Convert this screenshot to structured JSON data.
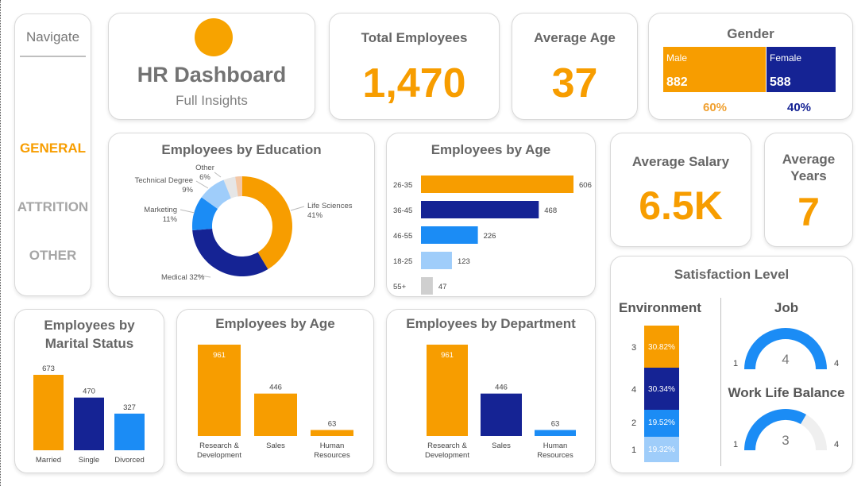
{
  "nav": {
    "title": "Navigate",
    "items": [
      "GENERAL",
      "ATTRITION",
      "OTHER"
    ]
  },
  "header": {
    "title": "HR Dashboard",
    "subtitle": "Full Insights"
  },
  "kpis": {
    "total_employees": {
      "label": "Total Employees",
      "value": "1,470"
    },
    "average_age": {
      "label": "Average Age",
      "value": "37"
    },
    "average_salary": {
      "label": "Average Salary",
      "value": "6.5K"
    },
    "average_years": {
      "label": "Average Years",
      "value": "7"
    }
  },
  "gender": {
    "title": "Gender",
    "male": {
      "label": "Male",
      "value": "882",
      "pct": "60%"
    },
    "female": {
      "label": "Female",
      "value": "588",
      "pct": "40%"
    }
  },
  "satisfaction": {
    "title": "Satisfaction Level",
    "environment": {
      "title": "Environment",
      "segments": [
        {
          "level": "3",
          "pct": "30.82%"
        },
        {
          "level": "4",
          "pct": "30.34%"
        },
        {
          "level": "2",
          "pct": "19.52%"
        },
        {
          "level": "1",
          "pct": "19.32%"
        }
      ]
    },
    "job": {
      "title": "Job",
      "min": "1",
      "max": "4",
      "value": "4"
    },
    "wlb": {
      "title": "Work Life Balance",
      "min": "1",
      "max": "4",
      "value": "3"
    }
  },
  "colors": {
    "orange": "#f79d00",
    "navy": "#152394",
    "blue": "#1b8cf5",
    "lightblue": "#9fcdfa",
    "grey": "#cfcfcf"
  },
  "chart_data": [
    {
      "type": "pie",
      "title": "Employees by Education",
      "labels": [
        "Life Sciences",
        "Medical",
        "Marketing",
        "Technical Degree",
        "Other"
      ],
      "values": [
        41,
        32,
        11,
        9,
        6
      ],
      "display": [
        "41%",
        "32%",
        "11%",
        "9%",
        "6%"
      ]
    },
    {
      "type": "bar",
      "title": "Employees by Age",
      "orientation": "horizontal",
      "categories": [
        "26-35",
        "36-45",
        "46-55",
        "18-25",
        "55+"
      ],
      "values": [
        606,
        468,
        226,
        123,
        47
      ]
    },
    {
      "type": "bar",
      "title": "Employees by Marital Status",
      "categories": [
        "Married",
        "Single",
        "Divorced"
      ],
      "values": [
        673,
        470,
        327
      ]
    },
    {
      "type": "bar",
      "title": "Employees by Age",
      "categories": [
        "Research & Development",
        "Sales",
        "Human Resources"
      ],
      "values": [
        961,
        446,
        63
      ]
    },
    {
      "type": "bar",
      "title": "Employees by Department",
      "categories": [
        "Research & Development",
        "Sales",
        "Human Resources"
      ],
      "values": [
        961,
        446,
        63
      ]
    }
  ]
}
